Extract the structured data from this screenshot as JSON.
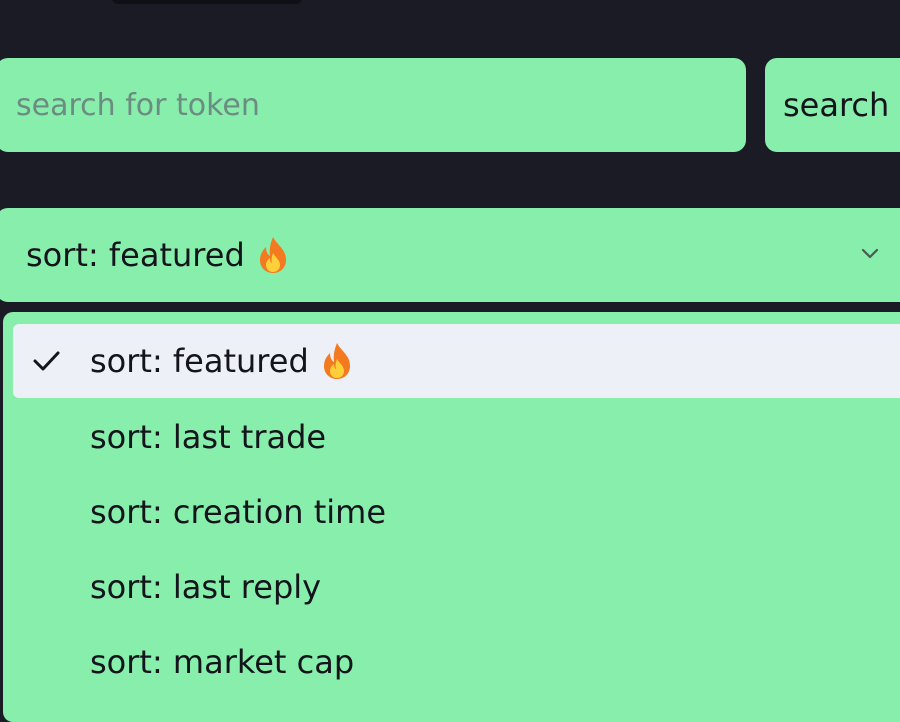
{
  "search": {
    "placeholder": "search for token",
    "value": "",
    "button_label": "search"
  },
  "sort": {
    "selected_label": "sort: featured",
    "selected_icon": "fire-icon",
    "options": [
      {
        "label": "sort: featured",
        "icon": "fire-icon",
        "selected": true
      },
      {
        "label": "sort: last trade",
        "selected": false
      },
      {
        "label": "sort: creation time",
        "selected": false
      },
      {
        "label": "sort: last reply",
        "selected": false
      },
      {
        "label": "sort: market cap",
        "selected": false
      }
    ]
  },
  "colors": {
    "background": "#1b1b26",
    "accent": "#87eeab",
    "selected_option_bg": "#eef0f7",
    "text": "#14141c"
  }
}
